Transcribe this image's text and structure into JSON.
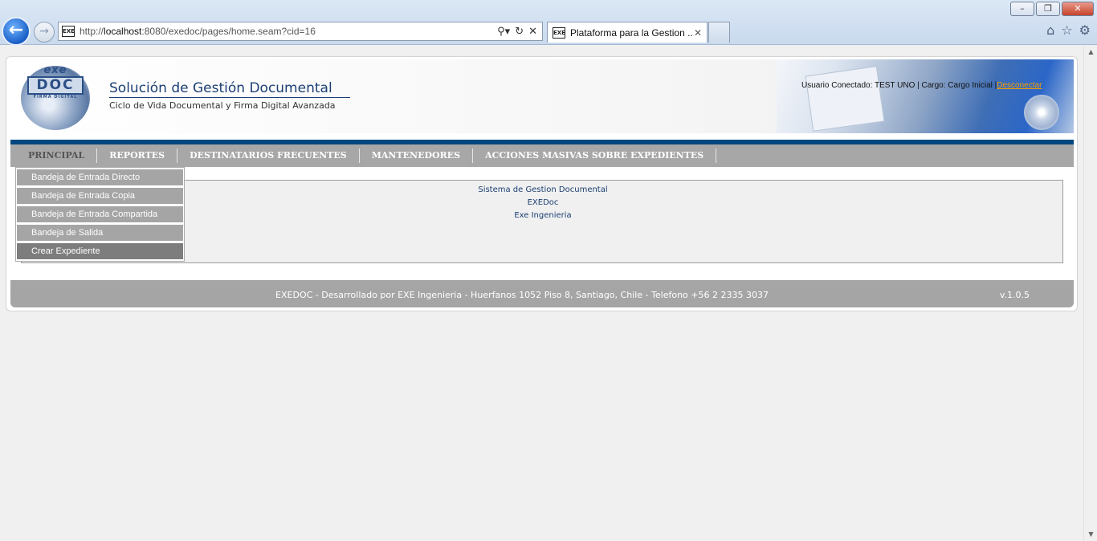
{
  "browser": {
    "url_prefix": "http://",
    "url_host": "localhost",
    "url_rest": ":8080/exedoc/pages/home.seam?cid=16",
    "tab_title": "Plataforma para la Gestion ...",
    "favicon_text": "EXE"
  },
  "header": {
    "logo_exe": "exe",
    "logo_doc": "DOC",
    "logo_sub": "FIRMA DIGITAL",
    "title": "Solución de Gestión Documental",
    "subtitle": "Ciclo de Vida Documental y Firma Digital Avanzada",
    "user_info": "Usuario Conectado: TEST UNO | Cargo: Cargo Inicial |",
    "logout_label": "Desconectar"
  },
  "nav": {
    "items": [
      "PRINCIPAL",
      "REPORTES",
      "DESTINATARIOS FRECUENTES",
      "MANTENEDORES",
      "ACCIONES MASIVAS SOBRE EXPEDIENTES"
    ]
  },
  "dropdown": {
    "items": [
      "Bandeja de Entrada Directo",
      "Bandeja de Entrada Copia",
      "Bandeja de Entrada Compartida",
      "Bandeja de Salida",
      "Crear Expediente"
    ]
  },
  "content": {
    "line1": "Sistema de Gestion Documental",
    "line2": "EXEDoc",
    "line3": "Exe Ingenieria"
  },
  "footer": {
    "text": "EXEDOC - Desarrollado por EXE Ingenieria - Huerfanos 1052 Piso 8, Santiago, Chile - Telefono +56 2 2335 3037",
    "version": "v.1.0.5"
  }
}
